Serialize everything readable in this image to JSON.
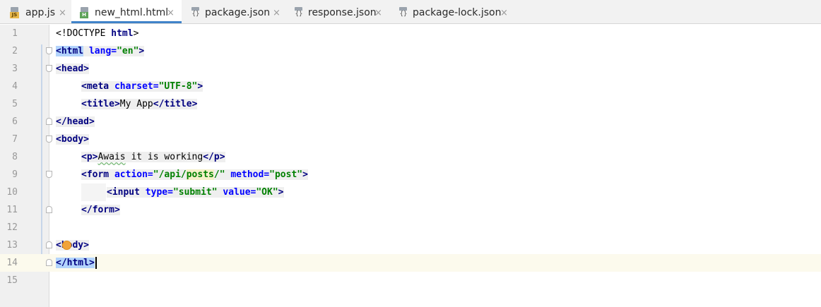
{
  "tabs": [
    {
      "label": "app.js",
      "icon": "js-file-icon",
      "active": false
    },
    {
      "label": "new_html.html",
      "icon": "html-file-icon",
      "active": true
    },
    {
      "label": "package.json",
      "icon": "json-file-icon",
      "active": false
    },
    {
      "label": "response.json",
      "icon": "json-file-icon",
      "active": false
    },
    {
      "label": "package-lock.json",
      "icon": "json-file-icon",
      "active": false
    }
  ],
  "close_glyph": "×",
  "line_numbers": [
    "1",
    "2",
    "3",
    "4",
    "5",
    "6",
    "7",
    "8",
    "9",
    "10",
    "11",
    "12",
    "13",
    "14",
    "15"
  ],
  "code": {
    "l1": {
      "doctype_open": "<!DOCTYPE ",
      "doctype_kw": "html",
      "doctype_close": ">"
    },
    "l2": {
      "open": "<html",
      "attr": " lang=",
      "val": "\"en\"",
      "close": ">"
    },
    "l3": {
      "open": "<head",
      "close": ">"
    },
    "l4": {
      "open": "<meta",
      "attr": " charset=",
      "val": "\"UTF-8\"",
      "close": ">"
    },
    "l5": {
      "open": "<title",
      "close": ">",
      "text": "My App",
      "end_open": "</title",
      "end_close": ">"
    },
    "l6": {
      "open": "</head",
      "close": ">"
    },
    "l7": {
      "open": "<body",
      "close": ">"
    },
    "l8": {
      "open": "<p",
      "close": ">",
      "word1": "Awais",
      "text": " it is working",
      "end_open": "</p",
      "end_close": ">"
    },
    "l9": {
      "open": "<form",
      "attr1": " action=",
      "val1_a": "\"/api/",
      "val1_b": "posts",
      "val1_c": "/\"",
      "attr2": " method=",
      "val2": "\"post\"",
      "close": ">"
    },
    "l10": {
      "open": "<input",
      "attr1": " type=",
      "val1": "\"submit\"",
      "attr2": " value=",
      "val2": "\"OK\"",
      "close": ">"
    },
    "l11": {
      "open": "</form",
      "close": ">"
    },
    "l13": {
      "lt": "<",
      "rest": "body",
      "close": ">"
    },
    "l14": {
      "open": "</html",
      "close": ">"
    }
  },
  "colors": {
    "accent_tab_underline": "#4083c9",
    "tag_keyword": "#000080",
    "attribute": "#0000ff",
    "string": "#008000",
    "current_line": "#fcfaed",
    "brace_match": "#b3d4fc"
  }
}
